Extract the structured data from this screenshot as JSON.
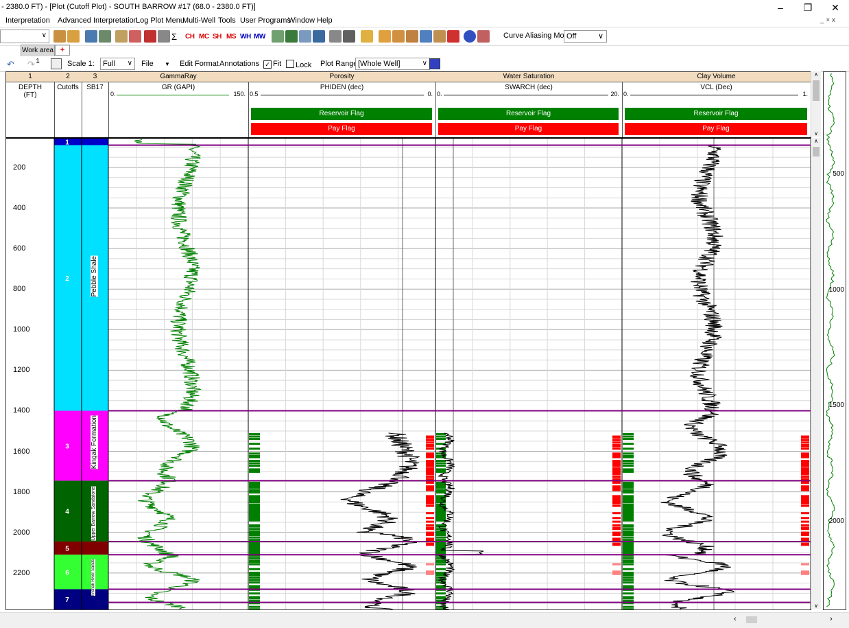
{
  "window": {
    "title": "- 2380.0 FT) - [Plot (Cutoff Plot) - SOUTH BARROW #17 (68.0 - 2380.0 FT)]",
    "minimize": "–",
    "restore": "❐",
    "close": "✕",
    "mdi_controls": "_ × x"
  },
  "menu": [
    "Interpretation",
    "Advanced Interpretation",
    "Log Plot Menu",
    "Multi-Well",
    "Tools",
    "User Programs",
    "Window",
    "Help"
  ],
  "toolbar": {
    "letter_buttons": [
      "CH",
      "MC",
      "SH",
      "MS",
      "WH",
      "MW"
    ],
    "curve_aliasing_label": "Curve Aliasing Mode :",
    "curve_aliasing_value": "Off",
    "curve_aliasing_arrow": "∨"
  },
  "tabs": {
    "work_area": "Work area 1",
    "add": "+"
  },
  "plot_toolbar": {
    "scale_label": "Scale 1:",
    "scale_value": "Full",
    "file": "File",
    "edit_format": "Edit Format",
    "annotations": "Annotations",
    "fit_label": "Fit",
    "fit_checked": "✓",
    "lock_label": "Lock",
    "plot_range_label": "Plot Range",
    "plot_range_value": "[Whole Well]"
  },
  "columns": [
    {
      "num": "1",
      "title": "DEPTH (FT)"
    },
    {
      "num": "2",
      "title": "Cutoffs"
    },
    {
      "num": "3",
      "title": "SB17"
    },
    {
      "num": "",
      "title": "GammaRay",
      "curve": "GR (GAPI)",
      "min": "0.",
      "max": "150."
    },
    {
      "num": "",
      "title": "Porosity",
      "curve": "PHIDEN (dec)",
      "min": "0.5",
      "max": "0."
    },
    {
      "num": "",
      "title": "Water Saturation",
      "curve": "SWARCH (dec)",
      "min": "0.",
      "max": "20."
    },
    {
      "num": "",
      "title": "Clay Volume",
      "curve": "VCL (Dec)",
      "min": "0.",
      "max": "1."
    }
  ],
  "flags": {
    "reservoir": "Reservoir Flag",
    "pay": "Pay Flag"
  },
  "depth_labels": [
    "200",
    "400",
    "600",
    "800",
    "1000",
    "1200",
    "1400",
    "1600",
    "1800",
    "2000",
    "2200"
  ],
  "zones": [
    {
      "id": "1",
      "color": "#0000c8"
    },
    {
      "id": "2",
      "color": "#00e0ff"
    },
    {
      "id": "3",
      "color": "#ff00ff"
    },
    {
      "id": "4",
      "color": "#006400"
    },
    {
      "id": "5",
      "color": "#800000"
    },
    {
      "id": "6",
      "color": "#33ff33"
    },
    {
      "id": "7",
      "color": "#000080"
    }
  ],
  "formations": [
    "Pebble Shale",
    "Kingak Formation",
    "Upper Barrow Sandstone",
    "Ivishak River Sands"
  ],
  "overview_labels": [
    "500",
    "1000",
    "1500",
    "2000"
  ],
  "colors": {
    "header_tan": "#f2dcbf",
    "reservoir_green": "#008000",
    "pay_red": "#ff0000",
    "gr_curve": "#008000",
    "zone_line": "#800080"
  }
}
